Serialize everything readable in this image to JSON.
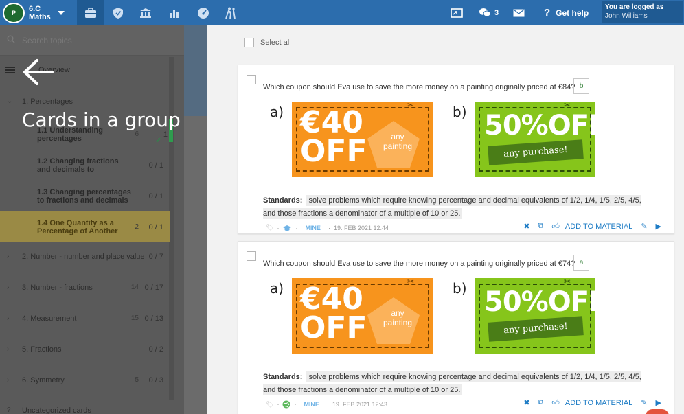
{
  "brand": {
    "logo_text": "P",
    "class_name": "6.C",
    "subject": "Maths"
  },
  "topbar": {
    "messages_count": "3",
    "help_label": "Get help",
    "logged_label": "You are logged as",
    "user_name": "John Williams"
  },
  "sidebar": {
    "search_placeholder": "Search topics",
    "overview_label": "Overview",
    "topics": [
      {
        "label": "1. Percentages",
        "num": "",
        "frac": ""
      },
      {
        "label": "2. Number - number and place value",
        "num": "",
        "frac": "0 / 7"
      },
      {
        "label": "3. Number - fractions",
        "num": "14",
        "frac": "0 / 17"
      },
      {
        "label": "4. Measurement",
        "num": "15",
        "frac": "0 / 13"
      },
      {
        "label": "5. Fractions",
        "num": "",
        "frac": "0 / 2"
      },
      {
        "label": "6. Symmetry",
        "num": "5",
        "frac": "0 / 3"
      },
      {
        "label": "Uncategorized cards",
        "num": "",
        "frac": ""
      }
    ],
    "subtopics": [
      {
        "label": "1.1 Understanding percentages",
        "num": "6",
        "frac": "1"
      },
      {
        "label": "1.2 Changing fractions and decimals to",
        "num": "",
        "frac": "0 / 1"
      },
      {
        "label": "1.3 Changing percentages to fractions and decimals",
        "num": "",
        "frac": "0 / 1"
      },
      {
        "label": "1.4 One Quantity as a Percentage of Another",
        "num": "2",
        "frac": "0 / 1"
      }
    ]
  },
  "overlay": {
    "title": "Cards in a group"
  },
  "main": {
    "select_all_label": "Select all",
    "cards": [
      {
        "question": "Which coupon should Eva use to save the more money on a painting originally priced at €84?",
        "answer": "b",
        "option_a_label": "a)",
        "option_b_label": "b)",
        "coupon_a_amount": "€40",
        "coupon_a_off": "OFF",
        "coupon_a_note": "any painting",
        "coupon_b_percent": "50%",
        "coupon_b_off": "OFF",
        "coupon_b_note": "any purchase!",
        "standards_label": "Standards:",
        "standards_text": "solve problems which require knowing percentage and decimal equivalents of 1/2, 1/4, 1/5, 2/5, 4/5, and those fractions a denominator of a multiple of 10 or 25.",
        "owner": "MINE",
        "date": "19. FEB 2021 12:44",
        "add_label": "ADD TO MATERIAL"
      },
      {
        "question": "Which coupon should Eva use to save the more money on a painting originally priced at €74?",
        "answer": "a",
        "option_a_label": "a)",
        "option_b_label": "b)",
        "coupon_a_amount": "€40",
        "coupon_a_off": "OFF",
        "coupon_a_note": "any painting",
        "coupon_b_percent": "50%",
        "coupon_b_off": "OFF",
        "coupon_b_note": "any purchase!",
        "standards_label": "Standards:",
        "standards_text": "solve problems which require knowing percentage and decimal equivalents of 1/2, 1/4, 1/5, 2/5, 4/5, and those fractions a denominator of a multiple of 10 or 25.",
        "owner": "MINE",
        "date": "19. FEB 2021 12:43",
        "add_label": "ADD TO MATERIAL"
      }
    ]
  },
  "colors": {
    "topbar": "#2c6dad",
    "accent": "#1e7cc5",
    "orange_coupon": "#f7941d",
    "green_coupon": "#86c51b"
  }
}
